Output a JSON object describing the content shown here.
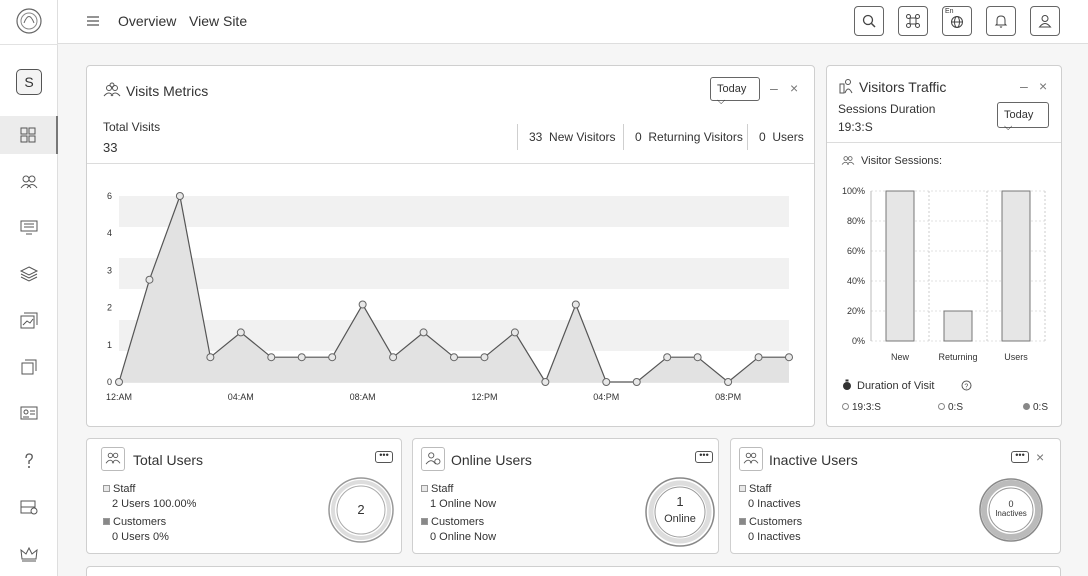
{
  "sidebar": {
    "user_initial": "S"
  },
  "topbar": {
    "overview": "Overview",
    "view_site": "View Site",
    "lang": "En"
  },
  "visits": {
    "title": "Visits Metrics",
    "range": "Today",
    "total_label": "Total Visits",
    "total_value": "33",
    "new_count": "33",
    "new_label": "New Visitors",
    "returning_count": "0",
    "returning_label": "Returning Visitors",
    "users_count": "0",
    "users_label": "Users"
  },
  "chart_data": {
    "type": "area",
    "yticks": [
      "0",
      "1",
      "2",
      "3",
      "4",
      "6"
    ],
    "xticks": [
      "12:AM",
      "04:AM",
      "08:AM",
      "12:PM",
      "04:PM",
      "08:PM"
    ],
    "x": [
      0,
      0.5,
      1,
      1.5,
      2,
      2.5,
      3,
      3.5,
      4,
      4.5,
      5,
      5.5,
      6,
      6.5,
      7,
      7.5,
      8,
      8.5,
      9,
      9.5,
      10,
      10.5,
      11
    ],
    "values": [
      0,
      3.3,
      6,
      0.8,
      1.6,
      0.8,
      0.8,
      0.8,
      2.5,
      0.8,
      1.6,
      0.8,
      0.8,
      1.6,
      0,
      2.5,
      0,
      0,
      0.8,
      0.8,
      0,
      0.8,
      0.8
    ],
    "ylim": [
      0,
      6
    ],
    "grid": "horizontal bands"
  },
  "traffic": {
    "title": "Visitors Traffic",
    "sessions_label": "Sessions Duration",
    "sessions_value": "19:3:S",
    "range": "Today",
    "sessions_title": "Visitor Sessions:",
    "duration_label": "Duration of Visit",
    "legend": [
      "19:3:S",
      "0:S",
      "0:S"
    ]
  },
  "sessions_chart": {
    "type": "bar",
    "categories": [
      "New",
      "Returning",
      "Users"
    ],
    "values": [
      100,
      20,
      100
    ],
    "yticks": [
      "100%",
      "80%",
      "60%",
      "40%",
      "20%",
      "0%"
    ],
    "ylim": [
      0,
      100
    ]
  },
  "total_users": {
    "title": "Total Users",
    "staff_label": "Staff",
    "staff_value": "2 Users 100.00%",
    "customers_label": "Customers",
    "customers_value": "0 Users 0%",
    "ring": "2"
  },
  "online_users": {
    "title": "Online Users",
    "staff_label": "Staff",
    "staff_value": "1 Online Now",
    "customers_label": "Customers",
    "customers_value": "0 Online Now",
    "ring_value": "1",
    "ring_label": "Online"
  },
  "inactive_users": {
    "title": "Inactive Users",
    "staff_label": "Staff",
    "staff_value": "0 Inactives",
    "customers_label": "Customers",
    "customers_value": "0 Inactives",
    "ring_value": "0",
    "ring_label": "Inactives"
  },
  "more_label": "•••"
}
